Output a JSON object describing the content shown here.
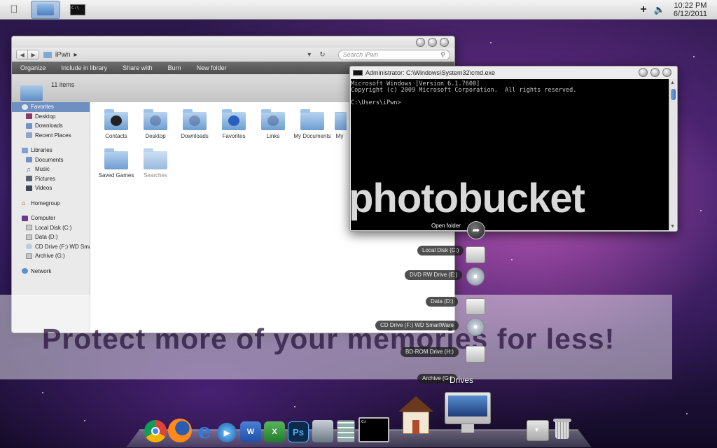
{
  "menubar": {
    "apple_icon": "apple-icon",
    "tasks": [
      {
        "name": "libraries-task",
        "icon": "libraries-icon",
        "active": true
      },
      {
        "name": "cmd-task",
        "icon": "cmd-icon",
        "active": false
      }
    ],
    "tray_plus": "+",
    "volume_icon": "volume-icon",
    "clock": {
      "time": "10:22 PM",
      "date": "6/12/2011"
    }
  },
  "explorer": {
    "breadcrumb": "iPwn",
    "search_placeholder": "Search iPwn",
    "toolbar": [
      "Organize",
      "Include in library",
      "Share with",
      "Burn",
      "New folder"
    ],
    "item_count": "11 items",
    "nav": {
      "favorites_header": "Favorites",
      "favorites": [
        "Desktop",
        "Downloads",
        "Recent Places"
      ],
      "libraries_header": "Libraries",
      "libraries": [
        "Documents",
        "Music",
        "Pictures",
        "Videos"
      ],
      "homegroup": "Homegroup",
      "computer_header": "Computer",
      "computer": [
        "Local Disk (C:)",
        "Data (D:)",
        "CD Drive (F:) WD SmartWare",
        "Archive (G:)"
      ],
      "network": "Network"
    },
    "folders": [
      {
        "label": "Contacts"
      },
      {
        "label": "Desktop"
      },
      {
        "label": "Downloads"
      },
      {
        "label": "Favorites"
      },
      {
        "label": "Links"
      },
      {
        "label": "My Documents"
      },
      {
        "label": "My"
      },
      {
        "label": "Saved Games"
      },
      {
        "label": "Searches"
      }
    ]
  },
  "cmd": {
    "title": "Administrator: C:\\Windows\\System32\\cmd.exe",
    "lines": [
      "Microsoft Windows [Version 6.1.7600]",
      "Copyright (c) 2009 Microsoft Corporation.  All rights reserved.",
      "",
      "C:\\Users\\iPwn>"
    ]
  },
  "watermark": {
    "logo": "photobucket",
    "slogan": "Protect more of your memories for less!"
  },
  "drives_stack": {
    "open_folder": "Open folder",
    "items": [
      "Local Disk (C:)",
      "DVD RW Drive (E:)",
      "Data (D:)",
      "CD Drive (F:) WD SmartWare",
      "BD-ROM Drive (H:)",
      "Archive (G:)"
    ],
    "title": "Drives"
  },
  "dock": {
    "apps": [
      "Chrome",
      "Firefox",
      "Internet Explorer",
      "Windows Media Player",
      "Word",
      "Excel",
      "Photoshop",
      "Steam",
      "Calculator",
      "Command Prompt"
    ],
    "ps_label": "Ps",
    "word_label": "W",
    "excel_label": "X"
  }
}
